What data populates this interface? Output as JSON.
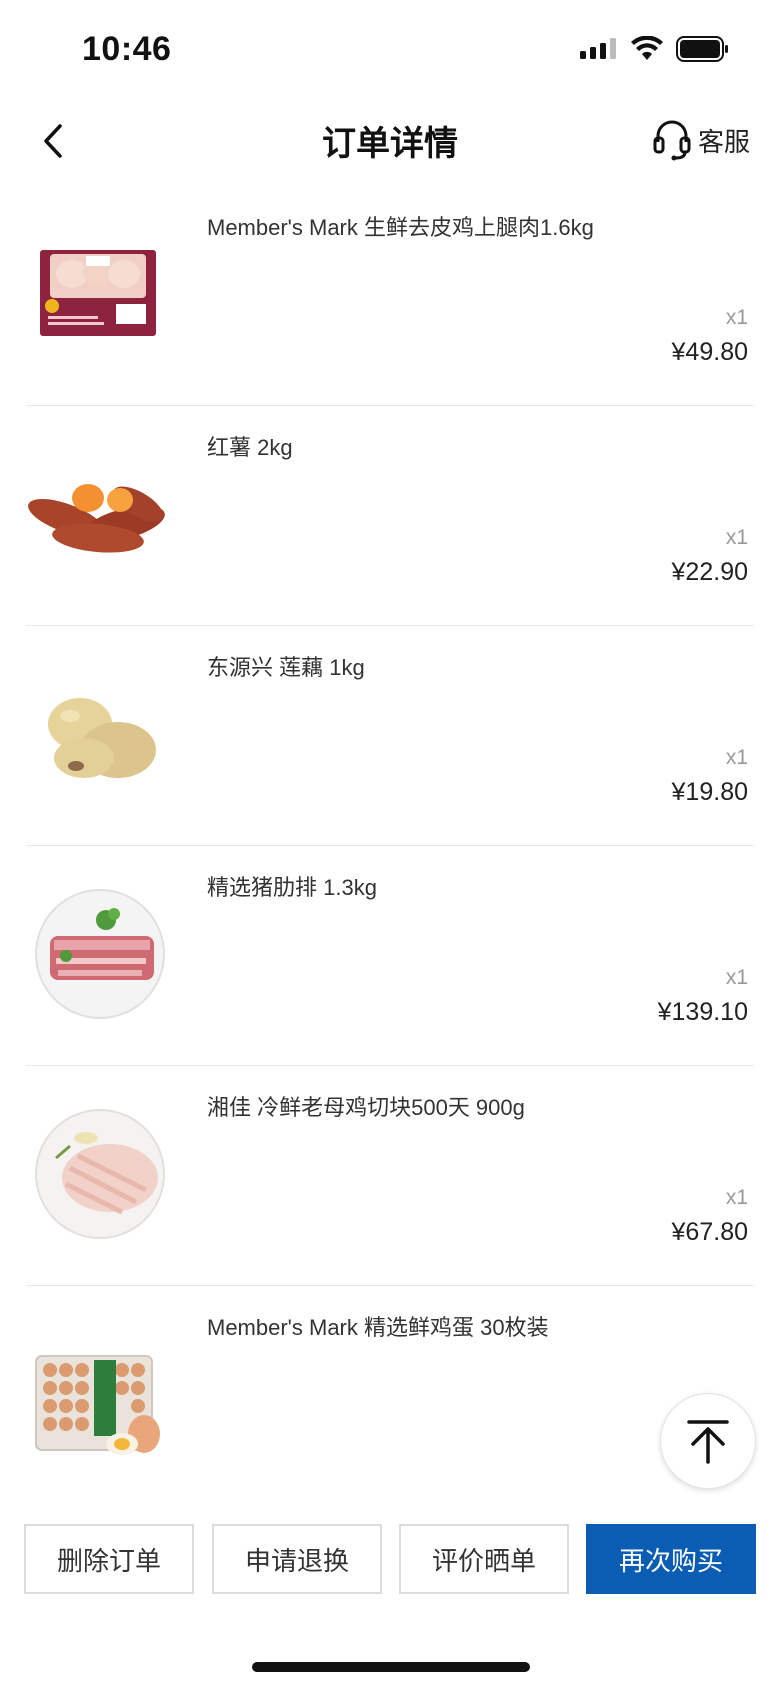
{
  "status": {
    "time": "10:46"
  },
  "header": {
    "title": "订单详情",
    "service_label": "客服"
  },
  "items": [
    {
      "name": "Member's Mark 生鲜去皮鸡上腿肉1.6kg",
      "qty": "x1",
      "price": "¥49.80"
    },
    {
      "name": "红薯 2kg",
      "qty": "x1",
      "price": "¥22.90"
    },
    {
      "name": "东源兴 莲藕 1kg",
      "qty": "x1",
      "price": "¥19.80"
    },
    {
      "name": "精选猪肋排 1.3kg",
      "qty": "x1",
      "price": "¥139.10"
    },
    {
      "name": "湘佳 冷鲜老母鸡切块500天 900g",
      "qty": "x1",
      "price": "¥67.80"
    },
    {
      "name": "Member's Mark 精选鲜鸡蛋 30枚装"
    }
  ],
  "actions": {
    "delete": "删除订单",
    "refund": "申请退换",
    "review": "评价晒单",
    "rebuy": "再次购买"
  },
  "colors": {
    "primary": "#0b5db3"
  },
  "icons": [
    "signal-icon",
    "wifi-icon",
    "battery-icon",
    "back-arrow-icon",
    "headset-icon",
    "back-to-top-icon"
  ]
}
